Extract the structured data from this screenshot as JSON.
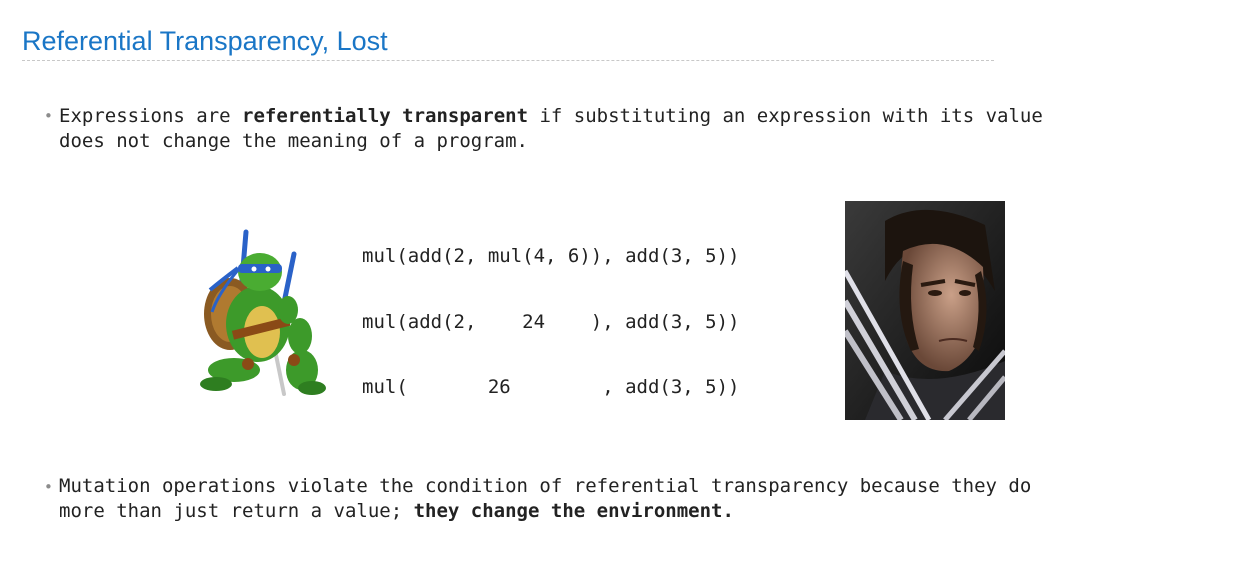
{
  "slide": {
    "title": "Referential Transparency, Lost"
  },
  "bullets": [
    {
      "line1_before": "Expressions are ",
      "line1_bold": "referentially transparent",
      "line1_after": " if substituting an expression with its value",
      "line2": "does not change the meaning of a program."
    },
    {
      "line1": "Mutation operations violate the condition of referential transparency because they do",
      "line2_before": "more than just return a value; ",
      "line2_bold": "they change the environment."
    }
  ],
  "code": [
    "mul(add(2, mul(4, 6)), add(3, 5))",
    "mul(add(2,    24    ), add(3, 5))",
    "mul(       26        , add(3, 5))"
  ],
  "images": {
    "turtle": "ninja-turtle-image",
    "wolverine": "wolverine-photo"
  },
  "colors": {
    "title": "#1a76c6",
    "text": "#222222",
    "bullet": "#8c8c8c"
  }
}
